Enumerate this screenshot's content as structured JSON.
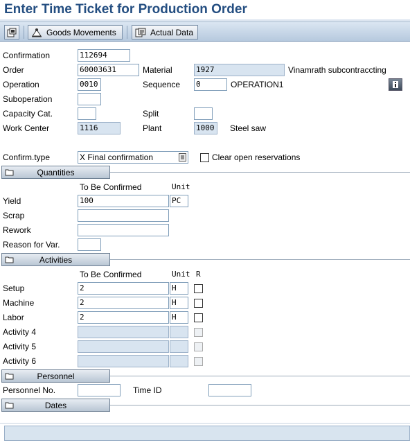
{
  "window": {
    "title": "Enter Time Ticket for Production Order"
  },
  "toolbar": {
    "goods_movements": "Goods Movements",
    "actual_data": "Actual Data"
  },
  "header": {
    "confirmation": {
      "label": "Confirmation",
      "value": "112694"
    },
    "order": {
      "label": "Order",
      "value": "60003631"
    },
    "material": {
      "label": "Material",
      "value": "1927",
      "text": "Vinamrath subcontraccting"
    },
    "operation": {
      "label": "Operation",
      "value": "0010"
    },
    "sequence": {
      "label": "Sequence",
      "value": "0",
      "text": "OPERATION1"
    },
    "suboperation": {
      "label": "Suboperation",
      "value": ""
    },
    "capacity_cat": {
      "label": "Capacity Cat.",
      "value": ""
    },
    "split": {
      "label": "Split",
      "value": ""
    },
    "work_center": {
      "label": "Work Center",
      "value": "1116"
    },
    "plant": {
      "label": "Plant",
      "value": "1000",
      "text": "Steel saw"
    }
  },
  "confirm_type": {
    "label": "Confirm.type",
    "value": "X Final confirmation",
    "clear_open_reservations": "Clear open reservations"
  },
  "quantities": {
    "section_title": "Quantities",
    "col_to_be_confirmed": "To Be Confirmed",
    "col_unit": "Unit",
    "yield": {
      "label": "Yield",
      "value": "100",
      "unit": "PC"
    },
    "scrap": {
      "label": "Scrap",
      "value": ""
    },
    "rework": {
      "label": "Rework",
      "value": ""
    },
    "reason_for_var": {
      "label": "Reason for Var.",
      "value": ""
    }
  },
  "activities": {
    "section_title": "Activities",
    "col_to_be_confirmed": "To Be Confirmed",
    "col_unit": "Unit",
    "col_r": "R",
    "rows": [
      {
        "label": "Setup",
        "value": "2",
        "unit": "H"
      },
      {
        "label": "Machine",
        "value": "2",
        "unit": "H"
      },
      {
        "label": "Labor",
        "value": "2",
        "unit": "H"
      },
      {
        "label": "Activity 4",
        "value": "",
        "unit": ""
      },
      {
        "label": "Activity 5",
        "value": "",
        "unit": ""
      },
      {
        "label": "Activity 6",
        "value": "",
        "unit": ""
      }
    ]
  },
  "personnel": {
    "section_title": "Personnel",
    "personnel_no": {
      "label": "Personnel No.",
      "value": ""
    },
    "time_id": {
      "label": "Time ID",
      "value": ""
    }
  },
  "dates": {
    "section_title": "Dates"
  },
  "colors": {
    "title": "#244e81",
    "readonly_field": "#d8e4f0",
    "toolbar": "#c5d5e6"
  }
}
